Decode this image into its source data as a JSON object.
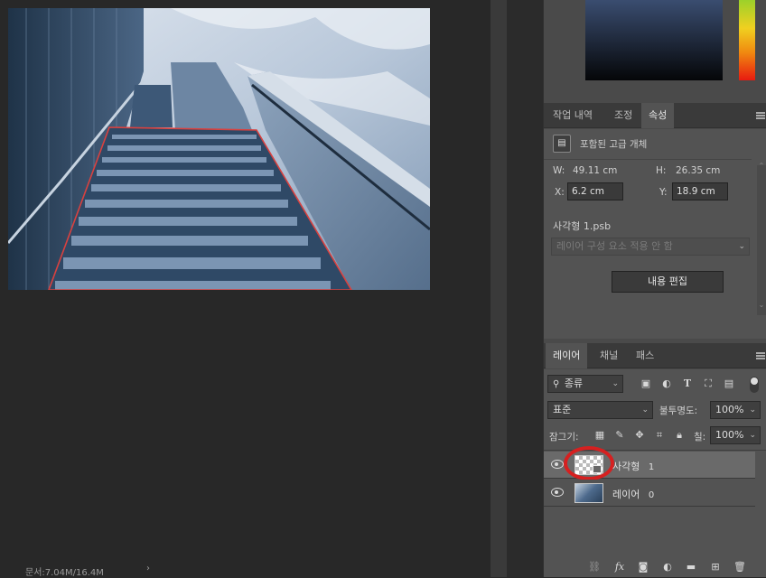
{
  "status": {
    "doc_size": "문서:7.04M/16.4M",
    "arrow": "›"
  },
  "properties_tabs": {
    "history": "작업 내역",
    "adjust": "조정",
    "props": "속성"
  },
  "properties": {
    "type_label": "포함된 고급 개체",
    "w_label": "W:",
    "w_value": "49.11 cm",
    "h_label": "H:",
    "h_value": "26.35 cm",
    "x_label": "X:",
    "x_value": "6.2 cm",
    "y_label": "Y:",
    "y_value": "18.9 cm",
    "file_name": "사각형 1.psb",
    "comp_placeholder": "레이어 구성 요소 적용 안 함",
    "edit_button": "내용 편집"
  },
  "layers_tabs": {
    "layers": "레이어",
    "channels": "채널",
    "paths": "패스"
  },
  "layers_panel": {
    "filter_label": "종류",
    "blend_mode": "표준",
    "opacity_label": "불투명도:",
    "opacity_value": "100%",
    "lock_label": "잠그기:",
    "fill_label": "칠:",
    "fill_value": "100%",
    "layers": [
      {
        "name": "사각형",
        "num": "1"
      },
      {
        "name": "레이어",
        "num": "0"
      }
    ]
  },
  "colors": {
    "accent_red": "#d62020",
    "panel_bg": "#4a4a4a"
  },
  "icons": [
    "search-icon",
    "image-filter-icon",
    "adjust-filter-icon",
    "type-filter-icon",
    "shape-filter-icon",
    "smart-filter-icon",
    "lock-pixels-icon",
    "brush-icon",
    "move-icon",
    "artboard-icon",
    "lock-icon",
    "link-icon",
    "fx-icon",
    "mask-icon",
    "adjustment-icon",
    "folder-icon",
    "new-layer-icon",
    "trash-icon",
    "eye-icon"
  ]
}
